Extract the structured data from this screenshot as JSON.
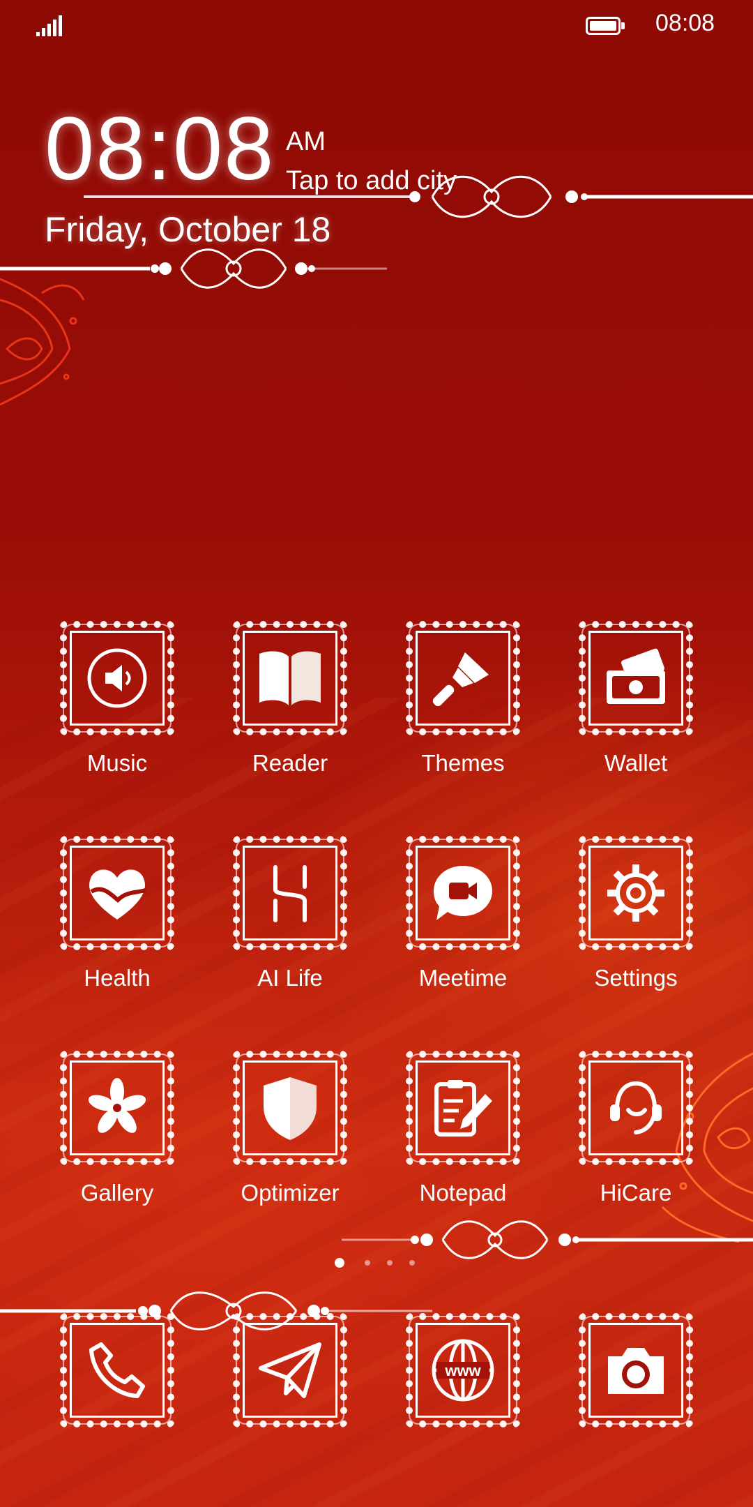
{
  "status_bar": {
    "time": "08:08",
    "signal_icon": "signal-icon",
    "battery_icon": "battery-icon"
  },
  "clock_widget": {
    "time": "08:08",
    "ampm": "AM",
    "city_prompt": "Tap to add city",
    "date": "Friday, October 18"
  },
  "apps": [
    {
      "label": "Music",
      "icon": "speaker-icon"
    },
    {
      "label": "Reader",
      "icon": "book-icon"
    },
    {
      "label": "Themes",
      "icon": "paintbrush-icon"
    },
    {
      "label": "Wallet",
      "icon": "wallet-icon"
    },
    {
      "label": "Health",
      "icon": "heart-icon"
    },
    {
      "label": "AI Life",
      "icon": "ai-life-icon"
    },
    {
      "label": "Meetime",
      "icon": "video-chat-icon"
    },
    {
      "label": "Settings",
      "icon": "gear-icon"
    },
    {
      "label": "Gallery",
      "icon": "flower-icon"
    },
    {
      "label": "Optimizer",
      "icon": "shield-icon"
    },
    {
      "label": "Notepad",
      "icon": "clipboard-pencil-icon"
    },
    {
      "label": "HiCare",
      "icon": "headset-icon"
    }
  ],
  "page_indicator": {
    "pages": 4,
    "active": 1
  },
  "dock": [
    {
      "icon": "phone-icon"
    },
    {
      "icon": "send-icon"
    },
    {
      "icon": "globe-www-icon",
      "text": "www"
    },
    {
      "icon": "camera-icon"
    }
  ],
  "colors": {
    "background_top": "#8e0a05",
    "background_bottom": "#c82a10",
    "foreground": "#ffffff"
  }
}
